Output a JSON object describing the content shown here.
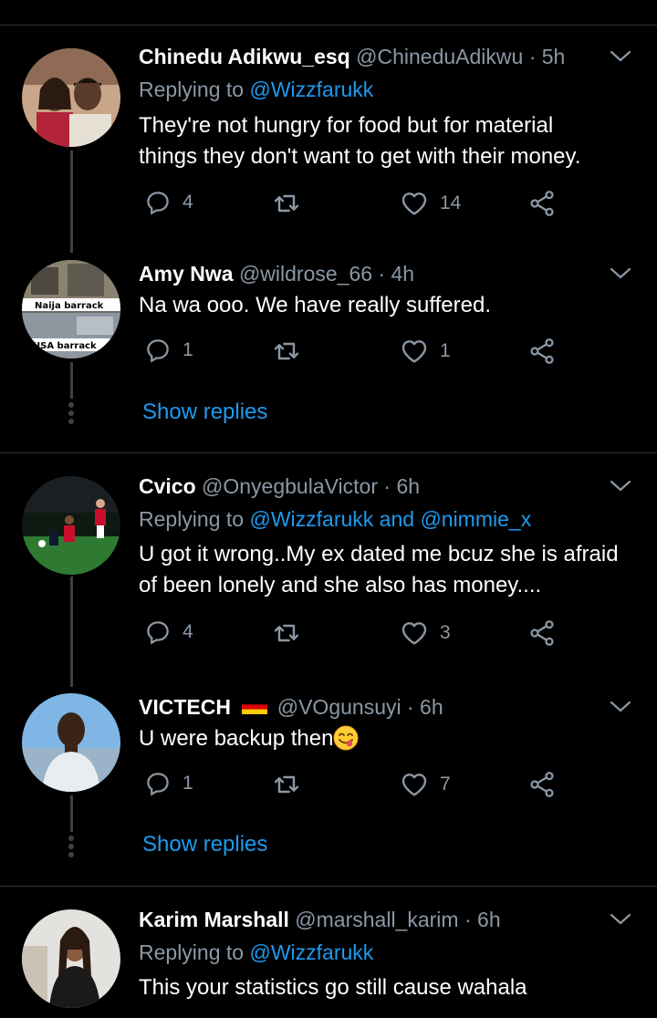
{
  "tweets": [
    {
      "name": "Chinedu Adikwu_esq",
      "handle": "@ChineduAdikwu",
      "sep": "·",
      "time": "5h",
      "replying_prefix": "Replying to",
      "replying_to": [
        "@Wizzfarukk"
      ],
      "replying_joiner": "",
      "text_lines": [
        "They're not hungry for food but for material",
        "things they don't want to get with their money."
      ],
      "replies": "4",
      "likes": "14",
      "avatar_icon": "couple-photo-avatar"
    },
    {
      "name": "Amy Nwa",
      "handle": "@wildrose_66",
      "sep": "·",
      "time": "4h",
      "text_lines": [
        "Na wa ooo. We have really suffered."
      ],
      "replies": "1",
      "likes": "1",
      "show_replies": "Show replies",
      "avatar_labels": [
        "Naija barrack",
        "USA barrack"
      ],
      "avatar_icon": "barracks-photo-avatar"
    },
    {
      "name": "Cvico",
      "handle": "@OnyegbulaVictor",
      "sep": "·",
      "time": "6h",
      "replying_prefix": "Replying to",
      "replying_to": [
        "@Wizzfarukk",
        "@nimmie_x"
      ],
      "replying_joiner": "and",
      "text_lines": [
        "U got it wrong..My ex dated me bcuz she is afraid",
        "of been lonely and she also has money...."
      ],
      "replies": "4",
      "likes": "3",
      "avatar_icon": "football-photo-avatar"
    },
    {
      "name": "VICTECH",
      "handle": "@VOgunsuyi",
      "sep": "·",
      "time": "6h",
      "text_lines": [
        "U were backup then"
      ],
      "replies": "1",
      "likes": "7",
      "show_replies": "Show replies",
      "flag_icon": "germany-flag-icon",
      "emoji_icon": "yum-face-emoji",
      "avatar_icon": "man-photo-avatar"
    },
    {
      "name": "Karim Marshall",
      "handle": "@marshall_karim",
      "sep": "·",
      "time": "6h",
      "replying_prefix": "Replying to",
      "replying_to": [
        "@Wizzfarukk"
      ],
      "replying_joiner": "",
      "text_lines": [
        "This your statistics go still cause wahala"
      ],
      "avatar_icon": "woman-photo-avatar"
    }
  ],
  "colors": {
    "background": "#000000",
    "secondary_text": "#8b98a5",
    "accent": "#1d9bf0",
    "divider": "#2f3336"
  }
}
